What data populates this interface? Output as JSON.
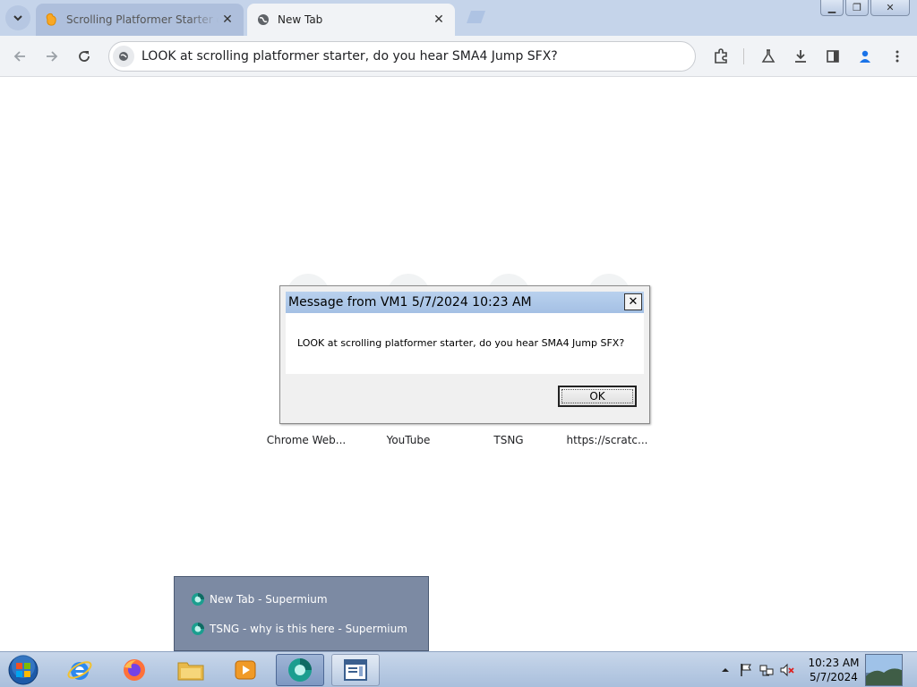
{
  "browser": {
    "tabs": [
      {
        "title": "Scrolling Platformer Starter on Scratch",
        "active": false
      },
      {
        "title": "New Tab",
        "active": true
      }
    ],
    "omnibox_text": "LOOK at scrolling platformer starter, do you hear SMA4 Jump SFX?",
    "colors": {
      "tabstrip": "#c5d4ea",
      "toolbar": "#f1f3f6",
      "profile_accent": "#1a73e8"
    }
  },
  "ntp": {
    "shortcuts": [
      {
        "label": "Chrome Web..."
      },
      {
        "label": "YouTube"
      },
      {
        "label": "TSNG"
      },
      {
        "label": "https://scratc..."
      }
    ]
  },
  "dialog": {
    "title": "Message from VM1 5/7/2024 10:23 AM",
    "close_glyph": "✕",
    "message": "LOOK at scrolling platformer starter, do you hear SMA4 Jump SFX?",
    "ok_label": "OK"
  },
  "jump_list": {
    "items": [
      {
        "label": "New Tab - Supermium",
        "icon": "supermium-icon"
      },
      {
        "label": "TSNG - why is this here - Supermium",
        "icon": "supermium-icon"
      }
    ]
  },
  "taskbar": {
    "apps": [
      "internet-explorer-icon",
      "firefox-icon",
      "file-explorer-icon",
      "media-player-icon",
      "supermium-icon",
      "window-app-icon"
    ],
    "clock": {
      "time": "10:23 AM",
      "date": "5/7/2024"
    }
  }
}
